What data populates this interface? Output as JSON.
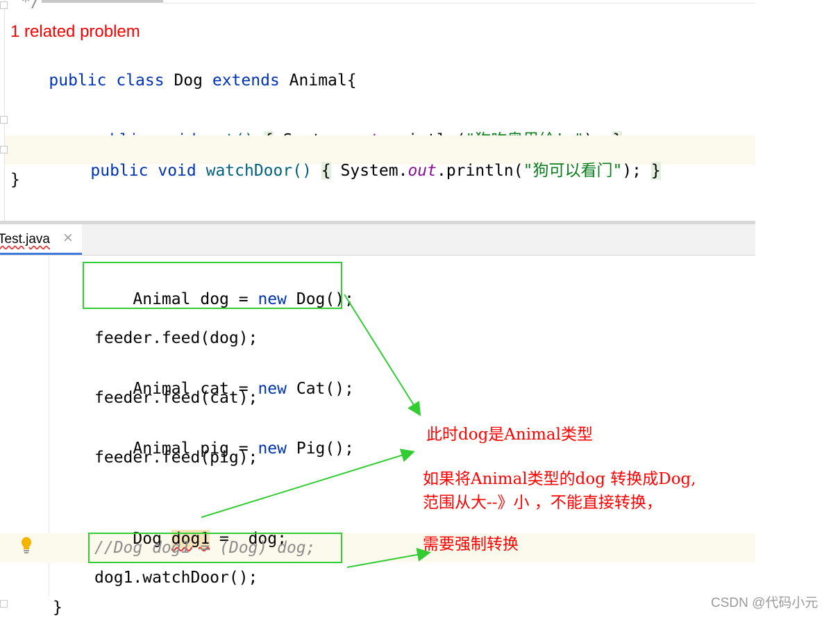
{
  "top_editor": {
    "comment_end": "*/",
    "problem_hint": "1 related problem",
    "line_class": {
      "kw1": "public",
      "kw2": "class",
      "name": "Dog",
      "kw3": "extends",
      "base": "Animal{"
    },
    "line_eat": {
      "kw1": "public",
      "kw2": "void",
      "method": "eat()",
      "sys": "System.",
      "out": "out",
      "println": ".println(",
      "str": "\"狗吃奥里给! \"",
      "end": ");"
    },
    "line_watch": {
      "kw1": "public",
      "kw2": "void",
      "method": "watchDoor()",
      "sys": "System.",
      "out": "out",
      "println": ".println(",
      "str": "\"狗可以看门\"",
      "end": ");"
    },
    "closing": "}"
  },
  "tab": {
    "label": "Test.java",
    "close_glyph": "×"
  },
  "bottom_editor": {
    "l1": {
      "type": "Animal",
      "var": "dog =",
      "kw": "new",
      "ctor": "Dog();"
    },
    "l2": "feeder.feed(dog);",
    "l3": {
      "type": "Animal",
      "var": "cat =",
      "kw": "new",
      "ctor": "Cat();"
    },
    "l4": "feeder.feed(cat);",
    "l5": {
      "type": "Animal",
      "var": "pig =",
      "kw": "new",
      "ctor": "Pig();"
    },
    "l6": "feeder.feed(pig);",
    "l7": {
      "type": "Dog",
      "var": "dog1",
      "rest": " =  dog;"
    },
    "l8": "//Dog dog1 = (Dog) dog;",
    "l9": "dog1.watchDoor();",
    "l10": "}"
  },
  "annotations": {
    "a1": "此时dog是Animal类型",
    "a2": "如果将Animal类型的dog 转换成Dog,",
    "a3": "范围从大--》小 ，不能直接转换，",
    "a4": "需要强制转换"
  },
  "watermark": "CSDN @代码小元",
  "colors": {
    "annotation": "#ff0000",
    "arrow": "#33cc33",
    "box": "#33cc33",
    "keyword": "#0033b3",
    "string": "#067d17",
    "highlight_line": "#fcfaed"
  }
}
